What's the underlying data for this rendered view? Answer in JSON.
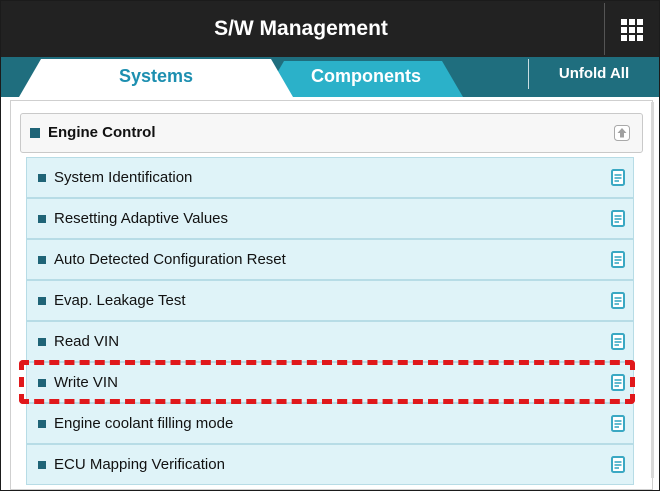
{
  "header": {
    "title": "S/W Management",
    "menu_icon": "grid-menu-icon"
  },
  "tabs": [
    {
      "label": "Systems",
      "active": true
    },
    {
      "label": "Components",
      "active": false
    }
  ],
  "toolbar": {
    "unfold_label": "Unfold All"
  },
  "group": {
    "label": "Engine Control",
    "collapse_icon": "collapse-up-icon",
    "items": [
      {
        "label": "System Identification",
        "icon": "document-icon"
      },
      {
        "label": "Resetting Adaptive Values",
        "icon": "document-icon"
      },
      {
        "label": "Auto Detected Configuration Reset",
        "icon": "document-icon"
      },
      {
        "label": "Evap. Leakage Test",
        "icon": "document-icon"
      },
      {
        "label": "Read VIN",
        "icon": "document-icon"
      },
      {
        "label": "Write VIN",
        "icon": "document-icon",
        "highlighted": true
      },
      {
        "label": "Engine coolant filling mode",
        "icon": "document-icon"
      },
      {
        "label": "ECU Mapping Verification",
        "icon": "document-icon"
      }
    ]
  },
  "colors": {
    "header_bg": "#222222",
    "tab_bar_bg": "#1f6e7e",
    "inactive_tab_bg": "#2bb1c9",
    "active_tab_text": "#1d8fb0",
    "row_bg": "#dff3f8",
    "highlight": "#e0181b"
  }
}
